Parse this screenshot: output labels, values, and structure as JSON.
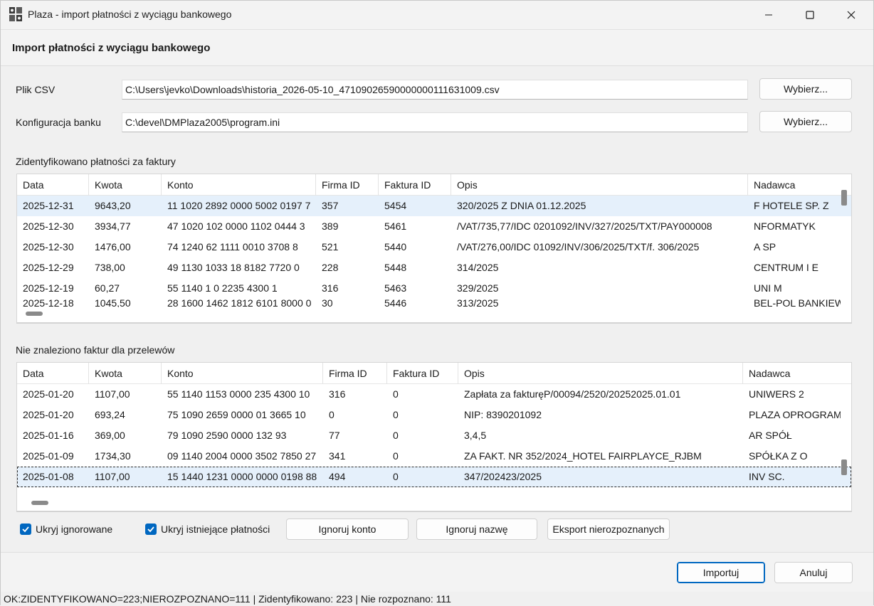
{
  "window": {
    "title": "Plaza - import płatności z wyciągu bankowego",
    "controls": {
      "minimize": "minimize-icon",
      "maximize": "maximize-icon",
      "close": "close-icon"
    }
  },
  "header": {
    "title": "Import płatności z wyciągu bankowego"
  },
  "form": {
    "csv_label": "Plik CSV",
    "csv_value": "C:\\Users\\jevko\\Downloads\\historia_2026-05-10_47109026590000000111631009.csv",
    "config_label": "Konfiguracja banku",
    "config_value": "C:\\devel\\DMPlaza2005\\program.ini",
    "browse_label": "Wybierz..."
  },
  "identified": {
    "label": "Zidentyfikowano płatności za faktury",
    "columns": [
      "Data",
      "Kwota",
      "Konto",
      "Firma ID",
      "Faktura ID",
      "Opis",
      "Nadawca"
    ],
    "rows": [
      [
        "2025-12-31",
        "9643,20",
        "11 1020 2892 0000 5002 0197 7",
        "357",
        "5454",
        "320/2025 Z DNIA 01.12.2025",
        "F        HOTELE SP. Z"
      ],
      [
        "2025-12-30",
        "3934,77",
        "47 1020 102   0000 1102 0444 3",
        "389",
        "5461",
        "/VAT/735,77/IDC          0201092/INV/327/2025/TXT/PAY000008",
        "           NFORMATYK"
      ],
      [
        "2025-12-30",
        "1476,00",
        "74 1240 62        1111 0010 3708 8",
        "521",
        "5440",
        "/VAT/276,00/IDC          01092/INV/306/2025/TXT/f. 306/2025",
        "                      A SP"
      ],
      [
        "2025-12-29",
        "738,00",
        "49 1130 1033      18 8182 7720 0",
        "228",
        "5448",
        "314/2025",
        "CENTRUM I       E"
      ],
      [
        "2025-12-19",
        "60,27",
        "55 1140 1           0 2235 4300 1",
        "316",
        "5463",
        "329/2025",
        "UNI                   M"
      ],
      [
        "2025-12-18",
        "1045,50",
        "28 1600 1462 1812 6101 8000 0",
        "30",
        "5446",
        "313/2025",
        "BEL-POL BANKIEW"
      ]
    ]
  },
  "not_found": {
    "label": "Nie znaleziono faktur dla przelewów",
    "columns": [
      "Data",
      "Kwota",
      "Konto",
      "Firma ID",
      "Faktura ID",
      "Opis",
      "Nadawca"
    ],
    "rows": [
      [
        "2025-01-20",
        "1107,00",
        "55 1140 1153 0000       235 4300 10",
        "316",
        "0",
        "Zapłata za fakturęP/00094/2520/20252025.01.01",
        "UNIWERS            2"
      ],
      [
        "2025-01-20",
        "693,24",
        "75 1090 2659 0000      01 3665 10",
        "0",
        "0",
        "NIP: 8390201092",
        "PLAZA OPROGRAM"
      ],
      [
        "2025-01-16",
        "369,00",
        "79 1090 2590 0000              132 93",
        "77",
        "0",
        "3,4,5",
        "AR                   SPÓŁ"
      ],
      [
        "2025-01-09",
        "1734,30",
        "09 1140 2004 0000 3502 7850 27",
        "341",
        "0",
        "ZA FAKT. NR 352/2024_HOTEL FAIRPLAYCE_RJBM",
        "             SPÓŁKA Z O"
      ],
      [
        "2025-01-08",
        "1107,00",
        "15 1440 1231 0000 0000 0198 88",
        "494",
        "0",
        "347/202423/2025",
        "INV                  SC."
      ]
    ]
  },
  "options": {
    "hide_ignored": "Ukryj ignorowane",
    "hide_existing": "Ukryj istniejące płatności",
    "ignore_account": "Ignoruj konto",
    "ignore_name": "Ignoruj nazwę",
    "export_unrecognized": "Eksport nierozpoznanych"
  },
  "footer": {
    "import": "Importuj",
    "cancel": "Anuluj"
  },
  "status": "OK:ZIDENTYFIKOWANO=223;NIEROZPOZNANO=111 | Zidentyfikowano: 223 | Nie rozpoznano: 111",
  "colors": {
    "accent": "#0067c0",
    "selection": "#e5f0fb"
  }
}
